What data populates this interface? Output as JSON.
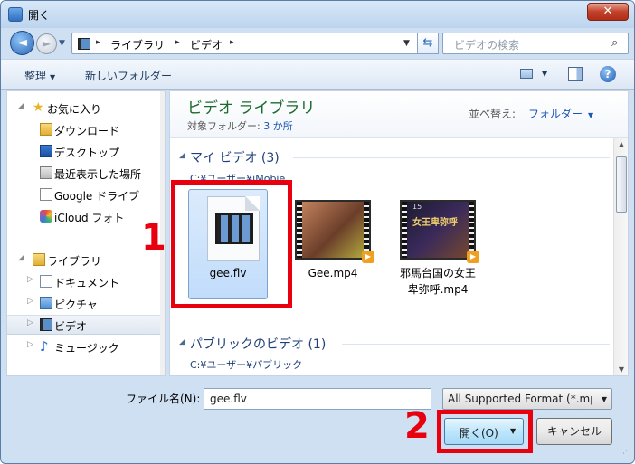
{
  "window": {
    "title": "開く",
    "close_glyph": "✕"
  },
  "nav": {
    "back_glyph": "◄",
    "fwd_glyph": "►",
    "history_glyph": "▼",
    "breadcrumb": [
      "ライブラリ",
      "ビデオ"
    ],
    "crumb_sep": "▸",
    "dropdown_glyph": "▼",
    "refresh_glyph": "⇆",
    "search_placeholder": "ビデオの検索",
    "search_glyph": "⌕"
  },
  "toolbar": {
    "organize_label": "整理",
    "organize_arrow": "▼",
    "new_folder_label": "新しいフォルダー",
    "view_dd_glyph": "▼",
    "help_glyph": "?"
  },
  "sidebar": {
    "favorites": {
      "label": "お気に入り",
      "icon": "star-icon"
    },
    "favorite_items": [
      {
        "label": "ダウンロード",
        "icon": "download-folder-icon"
      },
      {
        "label": "デスクトップ",
        "icon": "desktop-icon"
      },
      {
        "label": "最近表示した場所",
        "icon": "recent-places-icon"
      },
      {
        "label": "Google ドライブ",
        "icon": "google-drive-icon"
      },
      {
        "label": "iCloud フォト",
        "icon": "icloud-photos-icon"
      }
    ],
    "libraries": {
      "label": "ライブラリ",
      "icon": "library-icon"
    },
    "library_items": [
      {
        "label": "ドキュメント",
        "icon": "documents-icon"
      },
      {
        "label": "ピクチャ",
        "icon": "pictures-icon"
      },
      {
        "label": "ビデオ",
        "icon": "videos-icon",
        "selected": true
      },
      {
        "label": "ミュージック",
        "icon": "music-icon"
      }
    ],
    "expand_glyph": "▷",
    "collapse_glyph": "◢"
  },
  "library": {
    "title": "ビデオ ライブラリ",
    "subtitle_prefix": "対象フォルダー: ",
    "subtitle_link": "3 か所",
    "sort_label": "並べ替え:",
    "sort_value": "フォルダー",
    "sort_arrow": "▼"
  },
  "groups": [
    {
      "name": "マイ ビデオ (3)",
      "path": "C:¥ユーザー¥iMobie",
      "files": [
        {
          "name": "gee.flv",
          "type": "flv",
          "selected": true
        },
        {
          "name": "Gee.mp4",
          "type": "mp4"
        },
        {
          "name": "邪馬台国の女王\n卑弥呼.mp4",
          "type": "mp4",
          "thumb_number": "15",
          "thumb_caption": "女王卑弥呼"
        }
      ]
    },
    {
      "name": "パブリックのビデオ (1)",
      "path": "C:¥ユーザー¥パブリック",
      "files": []
    }
  ],
  "group_arrow": "◢",
  "scroll": {
    "up": "▲",
    "down": "▼"
  },
  "bottom": {
    "filename_label": "ファイル名(N):",
    "filename_value": "gee.flv",
    "format_value": "All Supported Format (*.mp",
    "format_arrow": "▼",
    "open_label": "開く(O)",
    "open_arrow": "▼",
    "cancel_label": "キャンセル",
    "grip_glyph": "⋰"
  },
  "annotations": {
    "step1": "1",
    "step2": "2"
  },
  "colors": {
    "highlight": "#e8000f",
    "link": "#1d56b5",
    "library_title": "#1a6b2d"
  }
}
